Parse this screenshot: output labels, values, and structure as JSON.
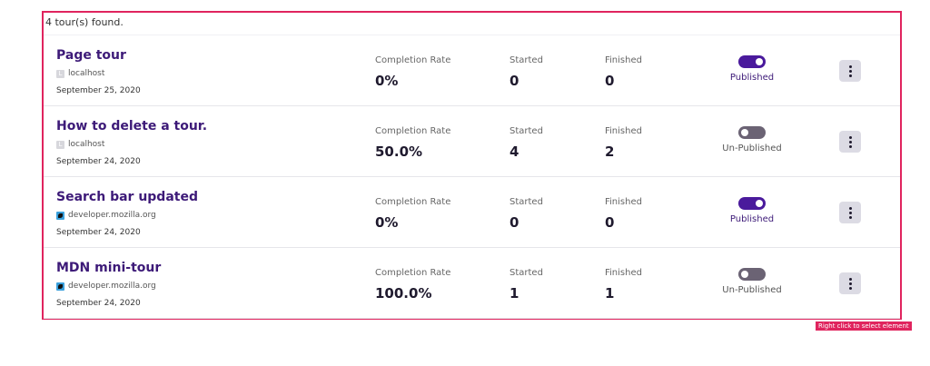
{
  "summary": "4 tour(s) found.",
  "labels": {
    "completion_rate": "Completion Rate",
    "started": "Started",
    "finished": "Finished"
  },
  "tours": [
    {
      "title": "Page tour",
      "host": "localhost",
      "favicon": "localhost-icon",
      "date": "September 25, 2020",
      "completion_rate": "0%",
      "started": "0",
      "finished": "0",
      "published": true,
      "status": "Published"
    },
    {
      "title": "How to delete a tour.",
      "host": "localhost",
      "favicon": "localhost-icon",
      "date": "September 24, 2020",
      "completion_rate": "50.0%",
      "started": "4",
      "finished": "2",
      "published": false,
      "status": "Un-Published"
    },
    {
      "title": "Search bar updated",
      "host": "developer.mozilla.org",
      "favicon": "mdn-icon",
      "date": "September 24, 2020",
      "completion_rate": "0%",
      "started": "0",
      "finished": "0",
      "published": true,
      "status": "Published"
    },
    {
      "title": "MDN mini-tour",
      "host": "developer.mozilla.org",
      "favicon": "mdn-icon",
      "date": "September 24, 2020",
      "completion_rate": "100.0%",
      "started": "1",
      "finished": "1",
      "published": false,
      "status": "Un-Published"
    }
  ],
  "inspector_hint": "Right click to select element",
  "colors": {
    "accent": "#4a1a9c",
    "title": "#3d1a78",
    "selection_border": "#e0245e",
    "toggle_off": "#6b6374"
  }
}
